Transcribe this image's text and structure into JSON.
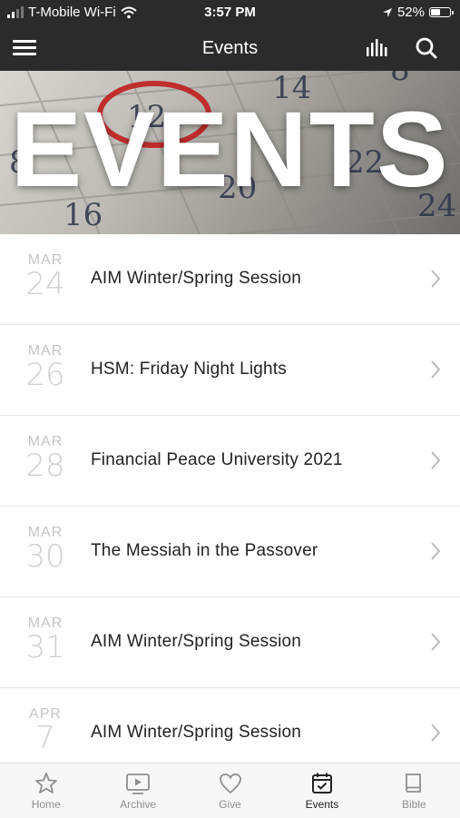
{
  "status_bar": {
    "carrier": "T-Mobile Wi-Fi",
    "time": "3:57 PM",
    "battery": "52%",
    "battery_level": 0.52
  },
  "nav": {
    "title": "Events",
    "menu_icon": "hamburger-menu-icon",
    "bars_icon": "equalizer-icon",
    "search_icon": "search-icon"
  },
  "banner": {
    "text": "EVENTS"
  },
  "events": [
    {
      "month": "MAR",
      "day": "24",
      "title": "AIM Winter/Spring Session"
    },
    {
      "month": "MAR",
      "day": "26",
      "title": "HSM: Friday Night Lights"
    },
    {
      "month": "MAR",
      "day": "28",
      "title": "Financial Peace University 2021"
    },
    {
      "month": "MAR",
      "day": "30",
      "title": "The Messiah in the Passover"
    },
    {
      "month": "MAR",
      "day": "31",
      "title": "AIM Winter/Spring Session"
    },
    {
      "month": "APR",
      "day": "7",
      "title": "AIM Winter/Spring Session"
    }
  ],
  "tabs": [
    {
      "label": "Home",
      "icon": "star-icon"
    },
    {
      "label": "Archive",
      "icon": "video-icon"
    },
    {
      "label": "Give",
      "icon": "heart-icon"
    },
    {
      "label": "Events",
      "icon": "calendar-icon",
      "active": true
    },
    {
      "label": "Bible",
      "icon": "book-icon"
    }
  ],
  "colors": {
    "header_bg": "#2b2b2b",
    "date_gray": "#c4c4c4",
    "active_tab": "#222222",
    "inactive_tab": "#8e8e8e"
  }
}
